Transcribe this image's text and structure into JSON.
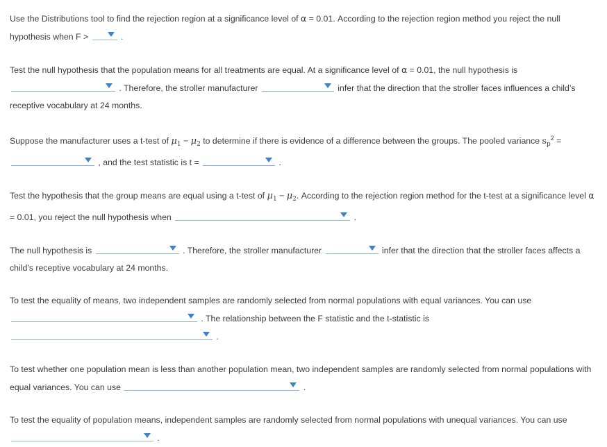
{
  "document": {
    "title": "Statistics worksheet - ANOVA and t-test rejection regions",
    "accent_color": "#3c83c8",
    "underline_color": "#8db3d8",
    "text_color": "#3b3b3b",
    "background_color": "#ffffff"
  },
  "symbols": {
    "alpha": "α",
    "mu": "μ",
    "minus": "−",
    "equals": "=",
    "sub1": "1",
    "sub2": "2",
    "s_var": "s",
    "sub_p": "p",
    "sup_2": "2",
    "period": ".",
    "comma": ","
  },
  "questions": [
    {
      "id": "q1",
      "segments": [
        {
          "type": "text",
          "value": "Use the Distributions tool to find the rejection region at a significance level of "
        },
        {
          "type": "alpha"
        },
        {
          "type": "text",
          "value": " = 0.01. According to the rejection region method you reject the null hypothesis when F > "
        },
        {
          "type": "dropdown",
          "name": "f-critical-value-dropdown",
          "width": "w-xs",
          "value": ""
        },
        {
          "type": "text",
          "value": " ."
        }
      ]
    },
    {
      "id": "q2",
      "segments": [
        {
          "type": "text",
          "value": "Test the null hypothesis that the population means for all treatments are equal. At a significance level of "
        },
        {
          "type": "alpha"
        },
        {
          "type": "text",
          "value": " = 0.01, the null hypothesis is "
        },
        {
          "type": "dropdown",
          "name": "null-hypothesis-decision-dropdown",
          "width": "w-l",
          "value": ""
        },
        {
          "type": "text",
          "value": " . Therefore, the stroller manufacturer "
        },
        {
          "type": "dropdown",
          "name": "can-infer-dropdown",
          "width": "w-m",
          "value": ""
        },
        {
          "type": "text",
          "value": " infer that the direction that the stroller faces influences a child’s receptive vocabulary at 24 months."
        }
      ]
    },
    {
      "id": "q3",
      "segments": [
        {
          "type": "text",
          "value": "Suppose the manufacturer uses a t-test of "
        },
        {
          "type": "mu",
          "sub": "1"
        },
        {
          "type": "text",
          "value": " − "
        },
        {
          "type": "mu",
          "sub": "2"
        },
        {
          "type": "text",
          "value": " to determine if there is evidence of a difference between the groups. The pooled variance "
        },
        {
          "type": "pooled-variance"
        },
        {
          "type": "text",
          "value": " = "
        },
        {
          "type": "dropdown",
          "name": "pooled-variance-value-dropdown",
          "width": "w-ml",
          "value": ""
        },
        {
          "type": "text",
          "value": " , and the test statistic is t = "
        },
        {
          "type": "dropdown",
          "name": "test-statistic-value-dropdown",
          "width": "w-m",
          "value": ""
        },
        {
          "type": "text",
          "value": " ."
        }
      ]
    },
    {
      "id": "q4",
      "segments": [
        {
          "type": "text",
          "value": "Test the hypothesis that the group means are equal using a t-test of "
        },
        {
          "type": "mu",
          "sub": "1"
        },
        {
          "type": "text",
          "value": " − "
        },
        {
          "type": "mu",
          "sub": "2"
        },
        {
          "type": "text",
          "value": ". According to the rejection region method for the t-test at a significance level "
        },
        {
          "type": "alpha"
        },
        {
          "type": "text",
          "value": " = 0.01, you reject the null hypothesis when "
        },
        {
          "type": "dropdown",
          "name": "t-rejection-region-dropdown",
          "width": "w-3xl",
          "value": ""
        },
        {
          "type": "text",
          "value": " ."
        }
      ]
    },
    {
      "id": "q5",
      "segments": [
        {
          "type": "text",
          "value": "The null hypothesis is "
        },
        {
          "type": "dropdown",
          "name": "null-hypothesis-status-dropdown",
          "width": "w-ml",
          "value": ""
        },
        {
          "type": "text",
          "value": " . Therefore, the stroller manufacturer "
        },
        {
          "type": "dropdown",
          "name": "can-infer-affects-dropdown",
          "width": "w-sm",
          "value": ""
        },
        {
          "type": "text",
          "value": " infer that the direction that the stroller faces affects a child’s receptive vocabulary at 24 months."
        }
      ]
    },
    {
      "id": "q6",
      "segments": [
        {
          "type": "text",
          "value": "To test the equality of means, two independent samples are randomly selected from normal populations with equal variances. You can use "
        },
        {
          "type": "dropdown",
          "name": "equality-of-means-test-dropdown",
          "width": "w-4xl",
          "value": ""
        },
        {
          "type": "text",
          "value": " . The relationship between the F statistic and the t-statistic is "
        },
        {
          "type": "dropdown",
          "name": "f-t-relationship-dropdown",
          "width": "w-5xl",
          "value": ""
        },
        {
          "type": "text",
          "value": " ."
        }
      ]
    },
    {
      "id": "q7",
      "segments": [
        {
          "type": "text",
          "value": "To test whether one population mean is less than another population mean, two independent samples are randomly selected from normal populations with equal variances. You can use "
        },
        {
          "type": "dropdown",
          "name": "one-sided-test-dropdown",
          "width": "w-3xl",
          "value": ""
        },
        {
          "type": "text",
          "value": " ."
        }
      ]
    },
    {
      "id": "q8",
      "segments": [
        {
          "type": "text",
          "value": "To test the equality of population means, independent samples are randomly selected from normal populations with unequal variances. You can use "
        },
        {
          "type": "dropdown",
          "name": "unequal-variances-test-dropdown",
          "width": "w-2xl",
          "value": ""
        },
        {
          "type": "text",
          "value": " ."
        }
      ]
    }
  ]
}
